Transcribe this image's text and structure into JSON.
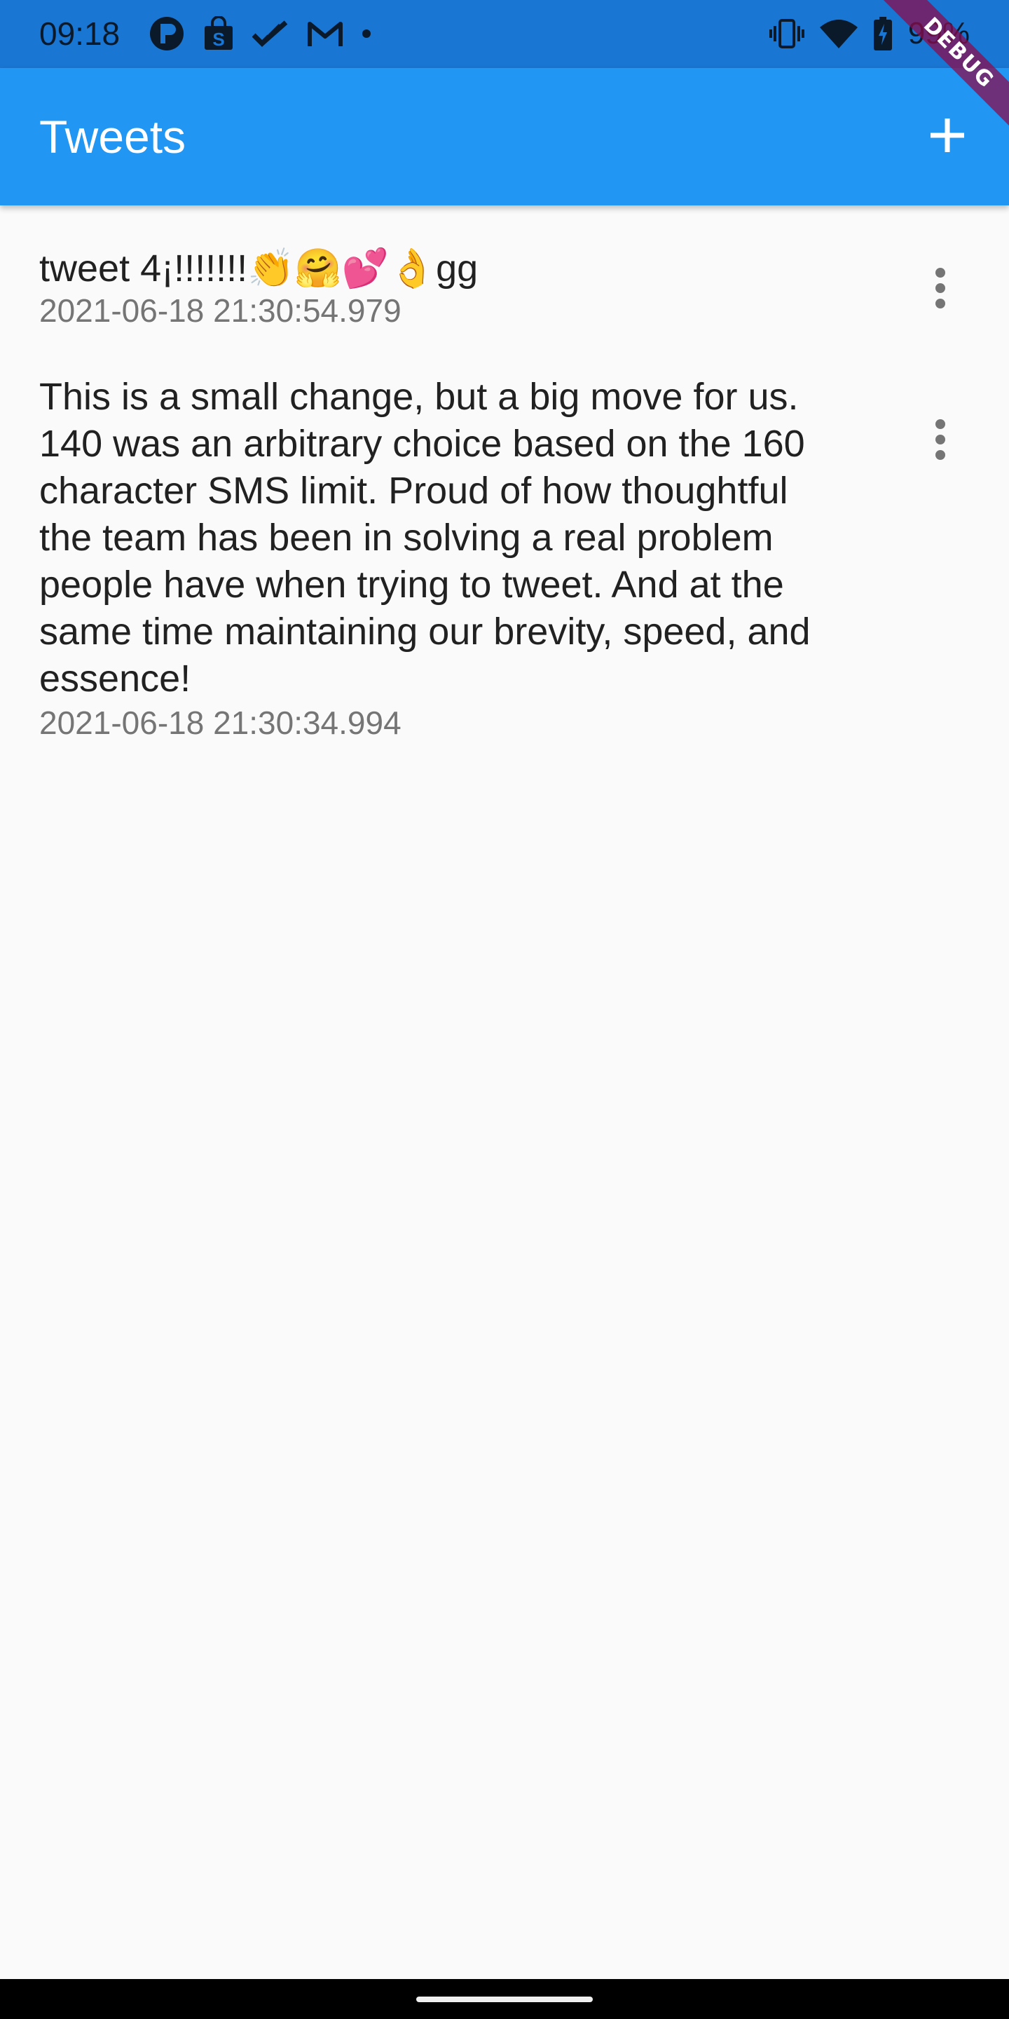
{
  "status_bar": {
    "time": "09:18",
    "battery": "99%",
    "left_icons": [
      "account-circle-icon",
      "shopping-bag-icon",
      "double-check-icon",
      "gmail-icon",
      "notification-dot-icon"
    ],
    "right_icons": [
      "vibrate-icon",
      "wifi-icon",
      "battery-charging-icon"
    ],
    "background": "#1976d2"
  },
  "app_bar": {
    "title": "Tweets",
    "action_icon": "add-icon",
    "background": "#2196f3"
  },
  "debug_banner": {
    "label": "DEBUG",
    "color": "#880e4f"
  },
  "tweets": [
    {
      "text_prefix": "tweet 4¡!!!!!!!",
      "emojis": [
        "👏",
        "🤗",
        "💕",
        "👌"
      ],
      "text_suffix": "gg",
      "timestamp": "2021-06-18 21:30:54.979",
      "menu_icon": "more-vert-icon"
    },
    {
      "text": "This is a small change, but a big move for us. 140 was an arbitrary choice based on the 160 character SMS limit. Proud of how thoughtful the team has been in solving a real problem people have when trying to tweet. And at the same time maintaining our brevity, speed, and essence!",
      "timestamp": "2021-06-18 21:30:34.994",
      "menu_icon": "more-vert-icon"
    }
  ]
}
